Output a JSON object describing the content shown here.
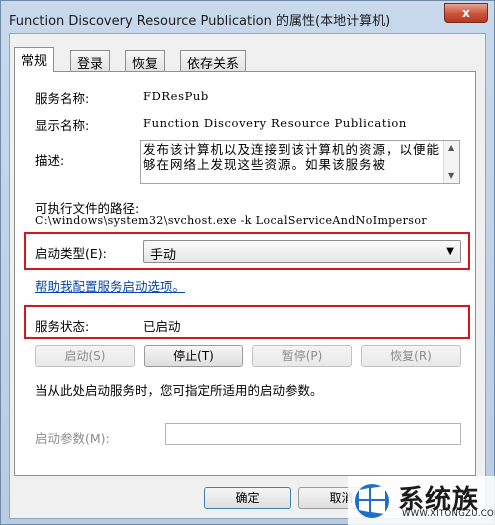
{
  "window": {
    "title": "Function Discovery Resource Publication 的属性(本地计算机)",
    "close_glyph": "x"
  },
  "tabs": [
    {
      "label": "常规"
    },
    {
      "label": "登录"
    },
    {
      "label": "恢复"
    },
    {
      "label": "依存关系"
    }
  ],
  "general": {
    "service_name_label": "服务名称:",
    "service_name_value": "FDResPub",
    "display_name_label": "显示名称:",
    "display_name_value": "Function Discovery Resource Publication",
    "description_label": "描述:",
    "description_value": "发布该计算机以及连接到该计算机的资源，以便能够在网络上发现这些资源。如果该服务被",
    "exe_path_label": "可执行文件的路径:",
    "exe_path_value": "C:\\windows\\system32\\svchost.exe -k LocalServiceAndNoImpersor",
    "startup_type_label": "启动类型(E):",
    "startup_type_value": "手动",
    "help_link": "帮助我配置服务启动选项。",
    "status_label": "服务状态:",
    "status_value": "已启动"
  },
  "service_buttons": {
    "start": "启动(S)",
    "stop": "停止(T)",
    "pause": "暂停(P)",
    "resume": "恢复(R)"
  },
  "hint_text": "当从此处启动服务时，您可指定所适用的启动参数。",
  "start_params_label": "启动参数(M):",
  "start_params_value": "",
  "dialog_buttons": {
    "ok": "确定",
    "cancel": "取消"
  },
  "watermark": {
    "name": "系统族",
    "url": "WWW.XITONGZU.COM"
  },
  "colors": {
    "highlight_frame": "#d6161c",
    "link": "#0645ad"
  }
}
